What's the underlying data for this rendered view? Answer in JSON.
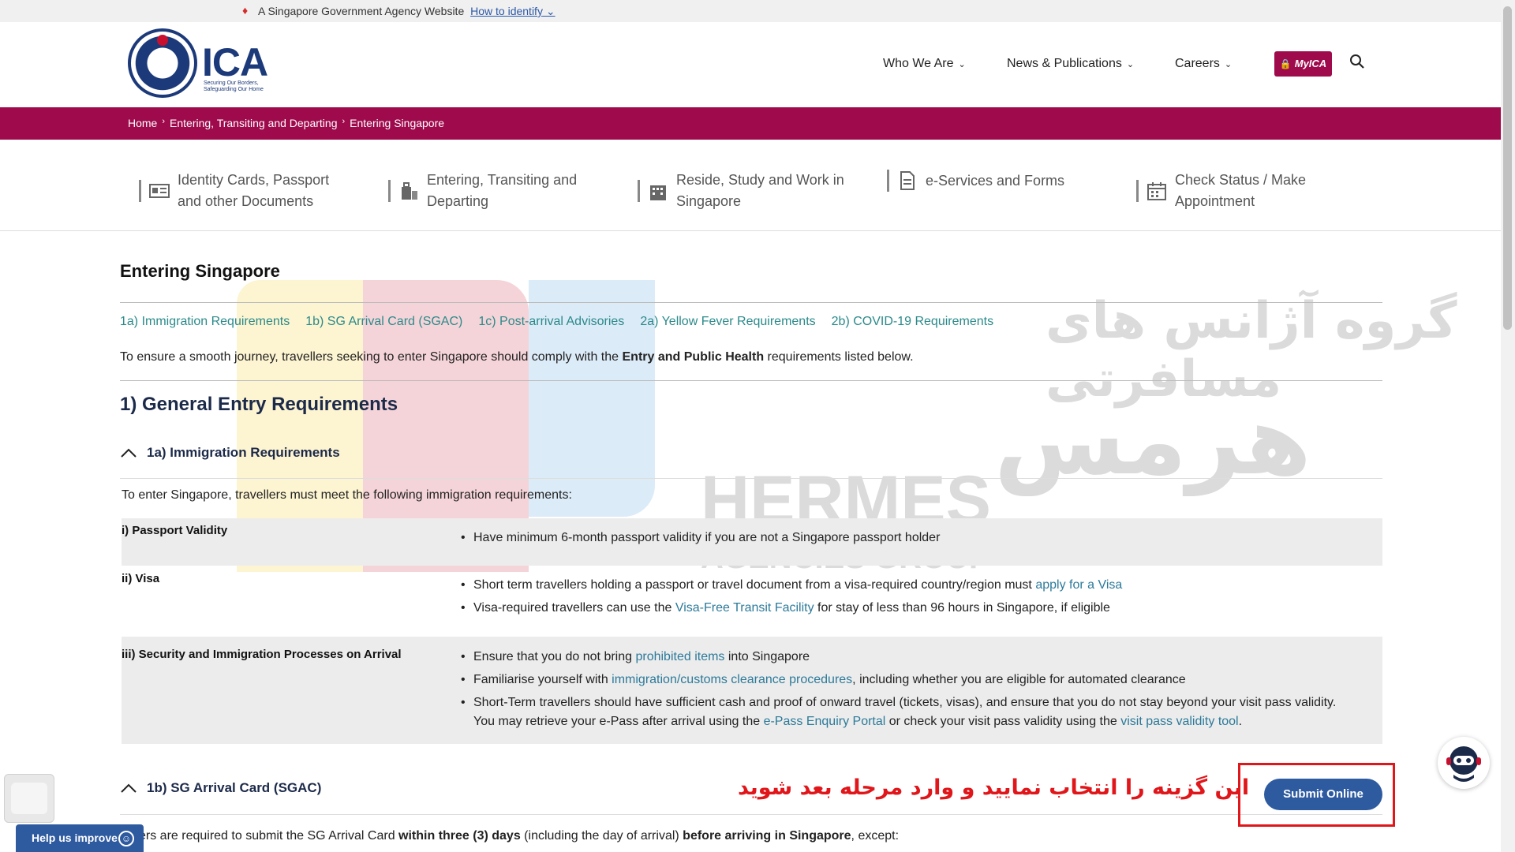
{
  "masthead": {
    "text": "A Singapore Government Agency Website",
    "link": "How to identify"
  },
  "logo": {
    "name": "ICA",
    "tagline": "Securing Our Borders, Safeguarding Our Home"
  },
  "nav": {
    "items": [
      "Who We Are",
      "News & Publications",
      "Careers"
    ],
    "myica": "MyICA"
  },
  "breadcrumb": [
    "Home",
    "Entering, Transiting and Departing",
    "Entering Singapore"
  ],
  "categories": [
    {
      "line1": "Identity Cards, Passport",
      "line2": "and other Documents",
      "icon": "id-card-icon"
    },
    {
      "line1": "Entering, Transiting and",
      "line2": "Departing",
      "icon": "luggage-icon"
    },
    {
      "line1": "Reside, Study and Work in",
      "line2": "Singapore",
      "icon": "building-icon"
    },
    {
      "line1": "e-Services and Forms",
      "line2": "",
      "icon": "document-icon"
    },
    {
      "line1": "Check Status / Make",
      "line2": "Appointment",
      "icon": "calendar-icon"
    }
  ],
  "page": {
    "title": "Entering Singapore",
    "tabs": [
      "1a) Immigration Requirements",
      "1b) SG Arrival Card (SGAC)",
      "1c) Post-arrival Advisories",
      "2a) Yellow Fever Requirements",
      "2b) COVID-19 Requirements"
    ],
    "intro_pre": "To ensure a smooth journey, travellers seeking to enter Singapore should comply with the ",
    "intro_bold": "Entry and Public Health",
    "intro_post": " requirements listed below.",
    "section_heading": "1) General Entry Requirements",
    "accordion_1a": "1a) Immigration Requirements",
    "leadin": "To enter Singapore, travellers must meet the following immigration requirements:",
    "rows": {
      "passport": {
        "label": "i) Passport Validity",
        "b1": "Have minimum 6-month passport validity if you are not a Singapore passport holder"
      },
      "visa": {
        "label": "ii) Visa",
        "b1_pre": "Short term travellers holding a passport or travel document from a visa-required country/region must ",
        "b1_link": "apply for a Visa",
        "b2_pre": "Visa-required travellers can use the ",
        "b2_link": "Visa-Free Transit Facility",
        "b2_post": " for stay of less than 96 hours in Singapore, if eligible"
      },
      "security": {
        "label": "iii) Security and Immigration Processes on Arrival",
        "b1_pre": "Ensure that you do not bring ",
        "b1_link": "prohibited items",
        "b1_post": " into Singapore",
        "b2_pre": "Familiarise yourself with ",
        "b2_link": "immigration/customs clearance procedures",
        "b2_post": ", including whether you are eligible for automated clearance",
        "b3_line1": "Short-Term travellers should have sufficient cash and proof of onward travel (tickets, visas), and ensure that you do not stay beyond your visit pass validity.",
        "b3_pre": "You may retrieve your e-Pass after arrival using the ",
        "b3_link1": "e-Pass Enquiry Portal",
        "b3_mid": " or check your visit pass validity using the ",
        "b3_link2": "visit pass validity tool",
        "b3_post": "."
      }
    },
    "accordion_1b": "1b) SG Arrival Card (SGAC)",
    "bottom_pre": "vellers are required to submit the SG Arrival Card ",
    "bottom_b1": "within three (3) days",
    "bottom_mid": " (including the day of arrival) ",
    "bottom_b2": "before arriving in Singapore",
    "bottom_post": ", except:"
  },
  "submit_label": "Submit Online",
  "annotation": "این گزینه را انتخاب نمایید و وارد مرحله بعد شوید",
  "watermark": {
    "line1": "گروه آژانس های مسافرتی",
    "brand": "HERMES",
    "sub": "AGENCIES GROUP",
    "script": "هرمس"
  },
  "help_label": "Help us improve",
  "colors": {
    "brand": "#9e0a4c",
    "navy": "#1c3a7a",
    "link": "#2c7a9a",
    "submit": "#2e5aa0",
    "annotation": "#e0161a"
  }
}
